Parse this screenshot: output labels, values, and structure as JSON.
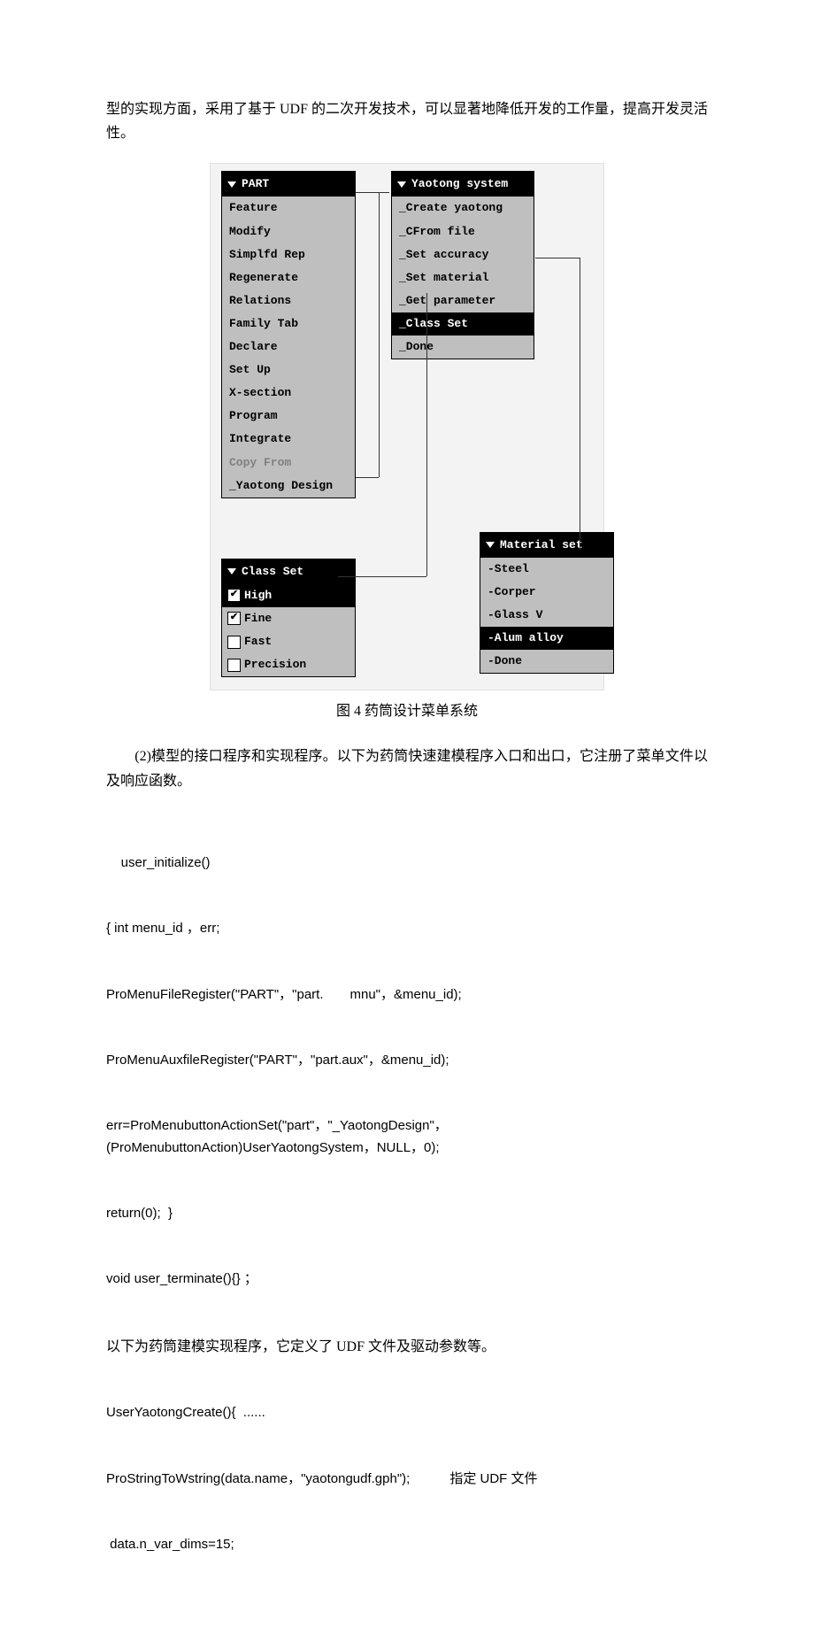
{
  "para1": "型的实现方面，采用了基于 UDF 的二次开发技术，可以显著地降低开发的工作量，提高开发灵活性。",
  "menus": {
    "part": {
      "title": "PART",
      "items": [
        "Feature",
        "Modify",
        "Simplfd Rep",
        "Regenerate",
        "Relations",
        "Family Tab",
        "Declare",
        "Set Up",
        "X-section",
        "Program",
        "Integrate",
        "Copy From",
        "_Yaotong Design"
      ]
    },
    "yaotong": {
      "title": "Yaotong system",
      "items": [
        "_Create yaotong",
        "_CFrom file",
        "_Set accuracy",
        "_Set material",
        "_Get parameter",
        "_Class Set",
        "_Done"
      ]
    },
    "classset": {
      "title": "Class Set",
      "items": [
        {
          "label": "High",
          "checked": true,
          "sel": true
        },
        {
          "label": "Fine",
          "checked": true,
          "sel": false
        },
        {
          "label": "Fast",
          "checked": false,
          "sel": false
        },
        {
          "label": "Precision",
          "checked": false,
          "sel": false
        }
      ]
    },
    "material": {
      "title": "Material set",
      "items": [
        "-Steel",
        "-Corper",
        "-Glass V",
        "-Alum alloy",
        "-Done"
      ]
    }
  },
  "caption": "图 4 药筒设计菜单系统",
  "para2_prefix": "　　(2)",
  "para2": "模型的接口程序和实现程序。以下为药筒快速建模程序入口和出口，它注册了菜单文件以及响应函数。",
  "code": [
    "    user_initialize()",
    "{ int menu_id ，err;",
    "ProMenuFileRegister(\"PART\"，\"part.　　mnu\"，&menu_id);",
    "ProMenuAuxfileRegister(\"PART\"，\"part.aux\"，&menu_id);",
    "err=ProMenubuttonActionSet(\"part\"，\"_YaotongDesign\"，(ProMenubuttonAction)UserYaotongSystem，NULL，0);",
    "return(0);  }",
    "void user_terminate(){} ；"
  ],
  "code_note": "以下为药筒建模实现程序，它定义了 UDF 文件及驱动参数等。",
  "code2": [
    "UserYaotongCreate(){  ......",
    "ProStringToWstring(data.name，\"yaotongudf.gph\");　　　指定 UDF 文件",
    " data.n_var_dims=15;"
  ]
}
